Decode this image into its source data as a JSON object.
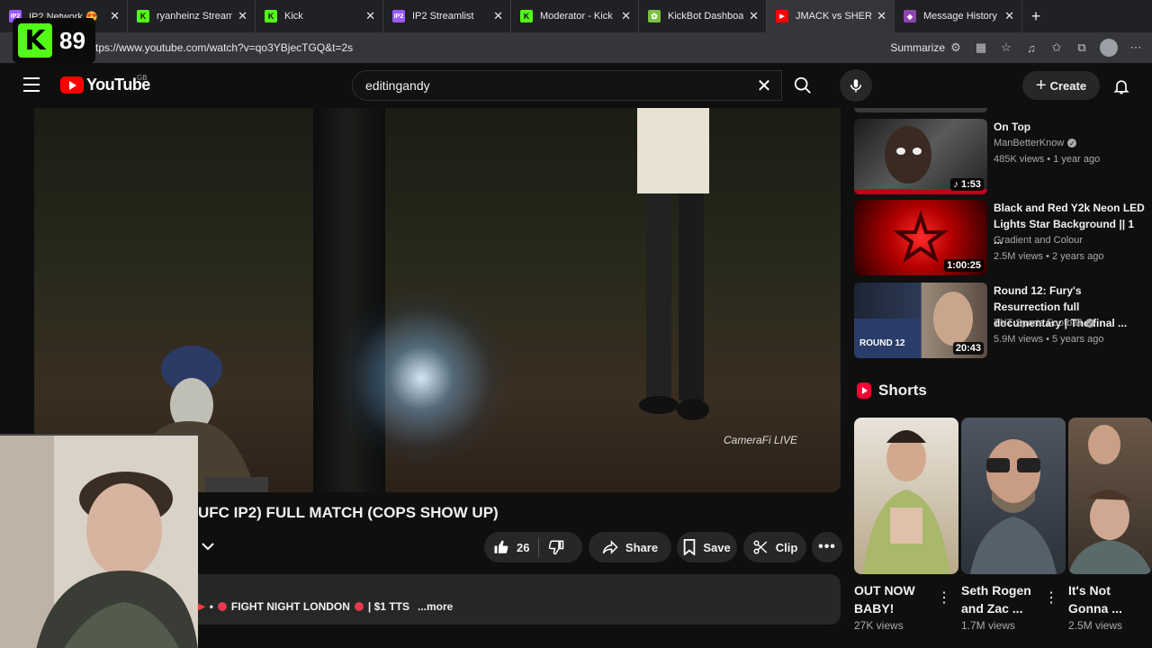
{
  "browser": {
    "tabs": [
      {
        "label": "IP2 Network 😍",
        "favicon_color": "#9b59ff",
        "favicon_text": "IP2"
      },
      {
        "label": "ryanheinz Stream -",
        "favicon_color": "#53fc18",
        "favicon_text": "K"
      },
      {
        "label": "Kick",
        "favicon_color": "#53fc18",
        "favicon_text": "K"
      },
      {
        "label": "IP2 Streamlist",
        "favicon_color": "#9b59ff",
        "favicon_text": "IP2"
      },
      {
        "label": "Moderator - Kick D",
        "favicon_color": "#53fc18",
        "favicon_text": "K"
      },
      {
        "label": "KickBot Dashboard",
        "favicon_color": "#7bc043",
        "favicon_text": "✿"
      },
      {
        "label": "JMACK vs SHERWI",
        "favicon_color": "#ff0000",
        "favicon_text": "▶"
      },
      {
        "label": "Message History - \\",
        "favicon_color": "#8e44ad",
        "favicon_text": "◆"
      }
    ],
    "url": "https://www.youtube.com/watch?v=qo3YBjecTGQ&t=2s",
    "summarize_label": "Summarize"
  },
  "kick_overlay": {
    "count": "89",
    "logo_letter": "K"
  },
  "youtube": {
    "logo_text": "YouTube",
    "region": "GB",
    "search_value": "editingandy",
    "create_label": "Create"
  },
  "video": {
    "title": "UFC IP2) FULL MATCH (COPS SHOW UP)",
    "watermark": "CameraFi LIVE",
    "like_count": "26",
    "share_label": "Share",
    "save_label": "Save",
    "clip_label": "Clip",
    "description_text": "FIGHT NIGHT LONDON",
    "description_tail": "| $1 TTS",
    "more_label": "...more"
  },
  "recommendations": [
    {
      "title": "On Top",
      "channel": "ManBetterKnow",
      "verified": true,
      "meta": "485K views • 1 year ago",
      "duration": "1:53",
      "music": true
    },
    {
      "title": "Black and Red Y2k Neon LED Lights Star Background || 1 ...",
      "channel": "Gradient and Colour",
      "verified": false,
      "meta": "2.5M views • 2 years ago",
      "duration": "1:00:25",
      "music": false
    },
    {
      "title": "Round 12: Fury's Resurrection full documentary | The final ...",
      "channel": "TNT Sports Football",
      "verified": true,
      "meta": "5.9M views • 5 years ago",
      "duration": "20:43",
      "music": false,
      "thumb_text": "ROUND 12"
    }
  ],
  "shorts": {
    "heading": "Shorts",
    "items": [
      {
        "title": "OUT NOW BABY!",
        "views": "27K views"
      },
      {
        "title": "Seth Rogen and Zac ...",
        "views": "1.7M views"
      },
      {
        "title": "It's Not Gonna ...",
        "views": "2.5M views"
      }
    ]
  }
}
